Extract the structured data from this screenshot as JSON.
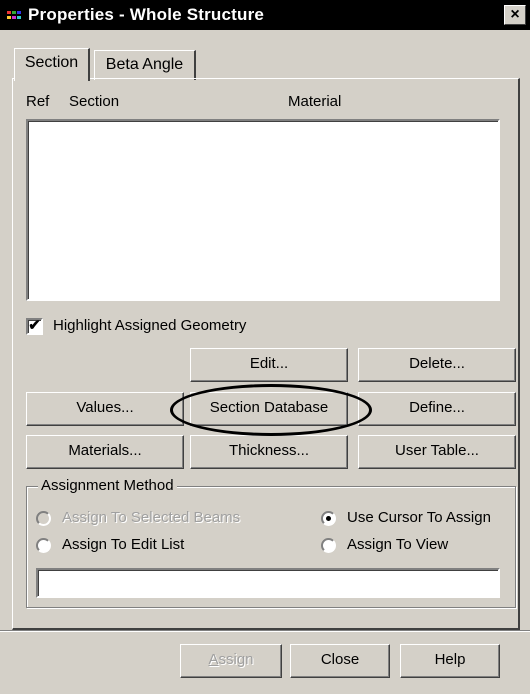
{
  "window": {
    "title": "Properties - Whole Structure",
    "close_glyph": "×"
  },
  "tabs": [
    {
      "label": "Section",
      "active": true
    },
    {
      "label": "Beta Angle",
      "active": false
    }
  ],
  "section_list": {
    "columns": [
      "Ref",
      "Section",
      "Material"
    ],
    "rows": []
  },
  "highlight_checkbox": {
    "label": "Highlight Assigned Geometry",
    "checked": true,
    "check_glyph": "✔"
  },
  "buttons": {
    "edit": "Edit...",
    "delete": "Delete...",
    "values": "Values...",
    "section_database": "Section Database",
    "define": "Define...",
    "materials": "Materials...",
    "thickness": "Thickness...",
    "user_table": "User Table..."
  },
  "assignment_method": {
    "title": "Assignment Method",
    "options": [
      {
        "label": "Assign To Selected Beams",
        "selected": false,
        "enabled": false
      },
      {
        "label": "Use Cursor To Assign",
        "selected": true,
        "enabled": true
      },
      {
        "label": "Assign To Edit List",
        "selected": false,
        "enabled": true
      },
      {
        "label": "Assign To View",
        "selected": false,
        "enabled": true
      }
    ],
    "edit_list_value": ""
  },
  "footer": {
    "assign_label": "Assign",
    "assign_accel_first": "A",
    "assign_accel_rest": "ssign",
    "close_label": "Close",
    "help_label": "Help"
  },
  "colors": {
    "dialog_bg": "#d4d0c8",
    "titlebar_bg": "#000000",
    "annotation_oval": "#000000"
  }
}
